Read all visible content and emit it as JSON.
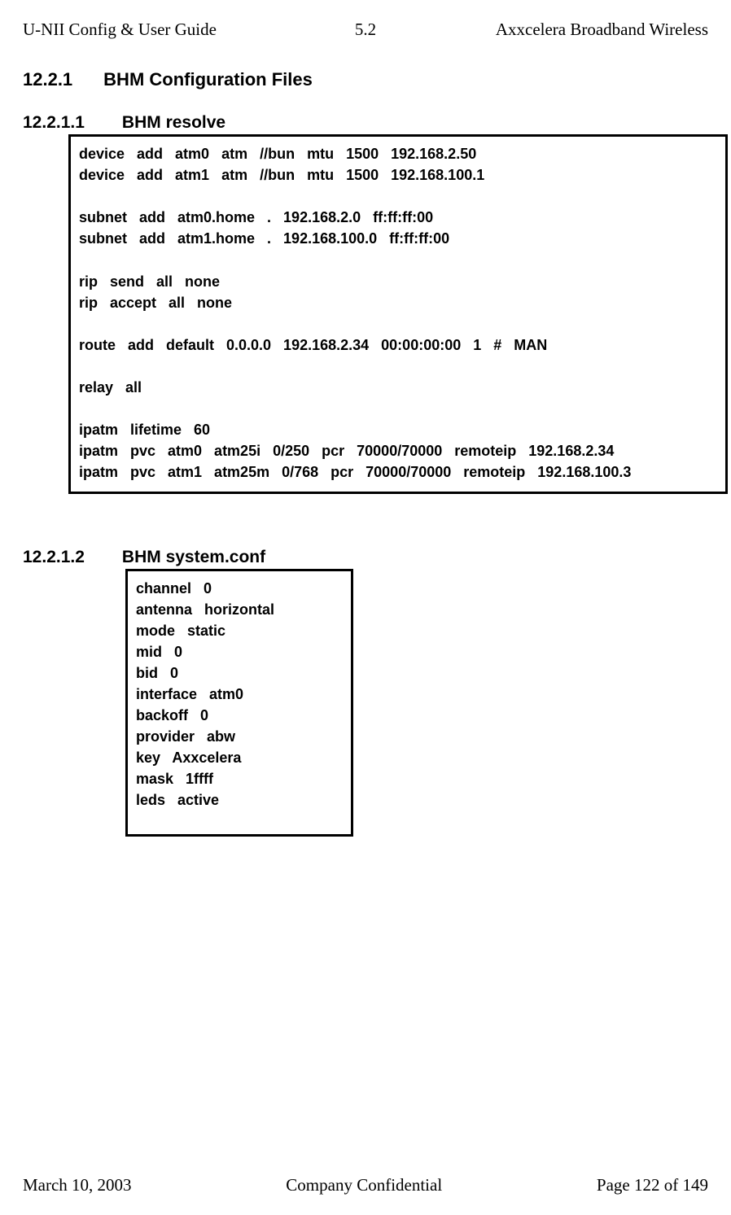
{
  "header": {
    "left": "U-NII Config & User Guide",
    "center": "5.2",
    "right": "Axxcelera Broadband Wireless"
  },
  "section_heading": {
    "number": "12.2.1",
    "title": "BHM Configuration Files"
  },
  "resolve": {
    "heading_number": "12.2.1.1",
    "heading_title": "BHM resolve",
    "content": "device   add   atm0   atm   //bun   mtu   1500   192.168.2.50\ndevice   add   atm1   atm   //bun   mtu   1500   192.168.100.1\n\nsubnet   add   atm0.home   .   192.168.2.0   ff:ff:ff:00\nsubnet   add   atm1.home   .   192.168.100.0   ff:ff:ff:00\n\nrip   send   all   none\nrip   accept   all   none\n\nroute   add   default   0.0.0.0   192.168.2.34   00:00:00:00   1   #   MAN\n\nrelay   all\n\nipatm   lifetime   60\nipatm   pvc   atm0   atm25i   0/250   pcr   70000/70000   remoteip   192.168.2.34\nipatm   pvc   atm1   atm25m   0/768   pcr   70000/70000   remoteip   192.168.100.3"
  },
  "systemconf": {
    "heading_number": "12.2.1.2",
    "heading_title": "BHM system.conf",
    "content": "channel   0\nantenna   horizontal\nmode   static\nmid   0\nbid   0\ninterface   atm0\nbackoff   0\nprovider   abw\nkey   Axxcelera\nmask   1ffff\nleds   active"
  },
  "footer": {
    "left": "March 10, 2003",
    "center": "Company Confidential",
    "right": "Page 122 of 149"
  }
}
